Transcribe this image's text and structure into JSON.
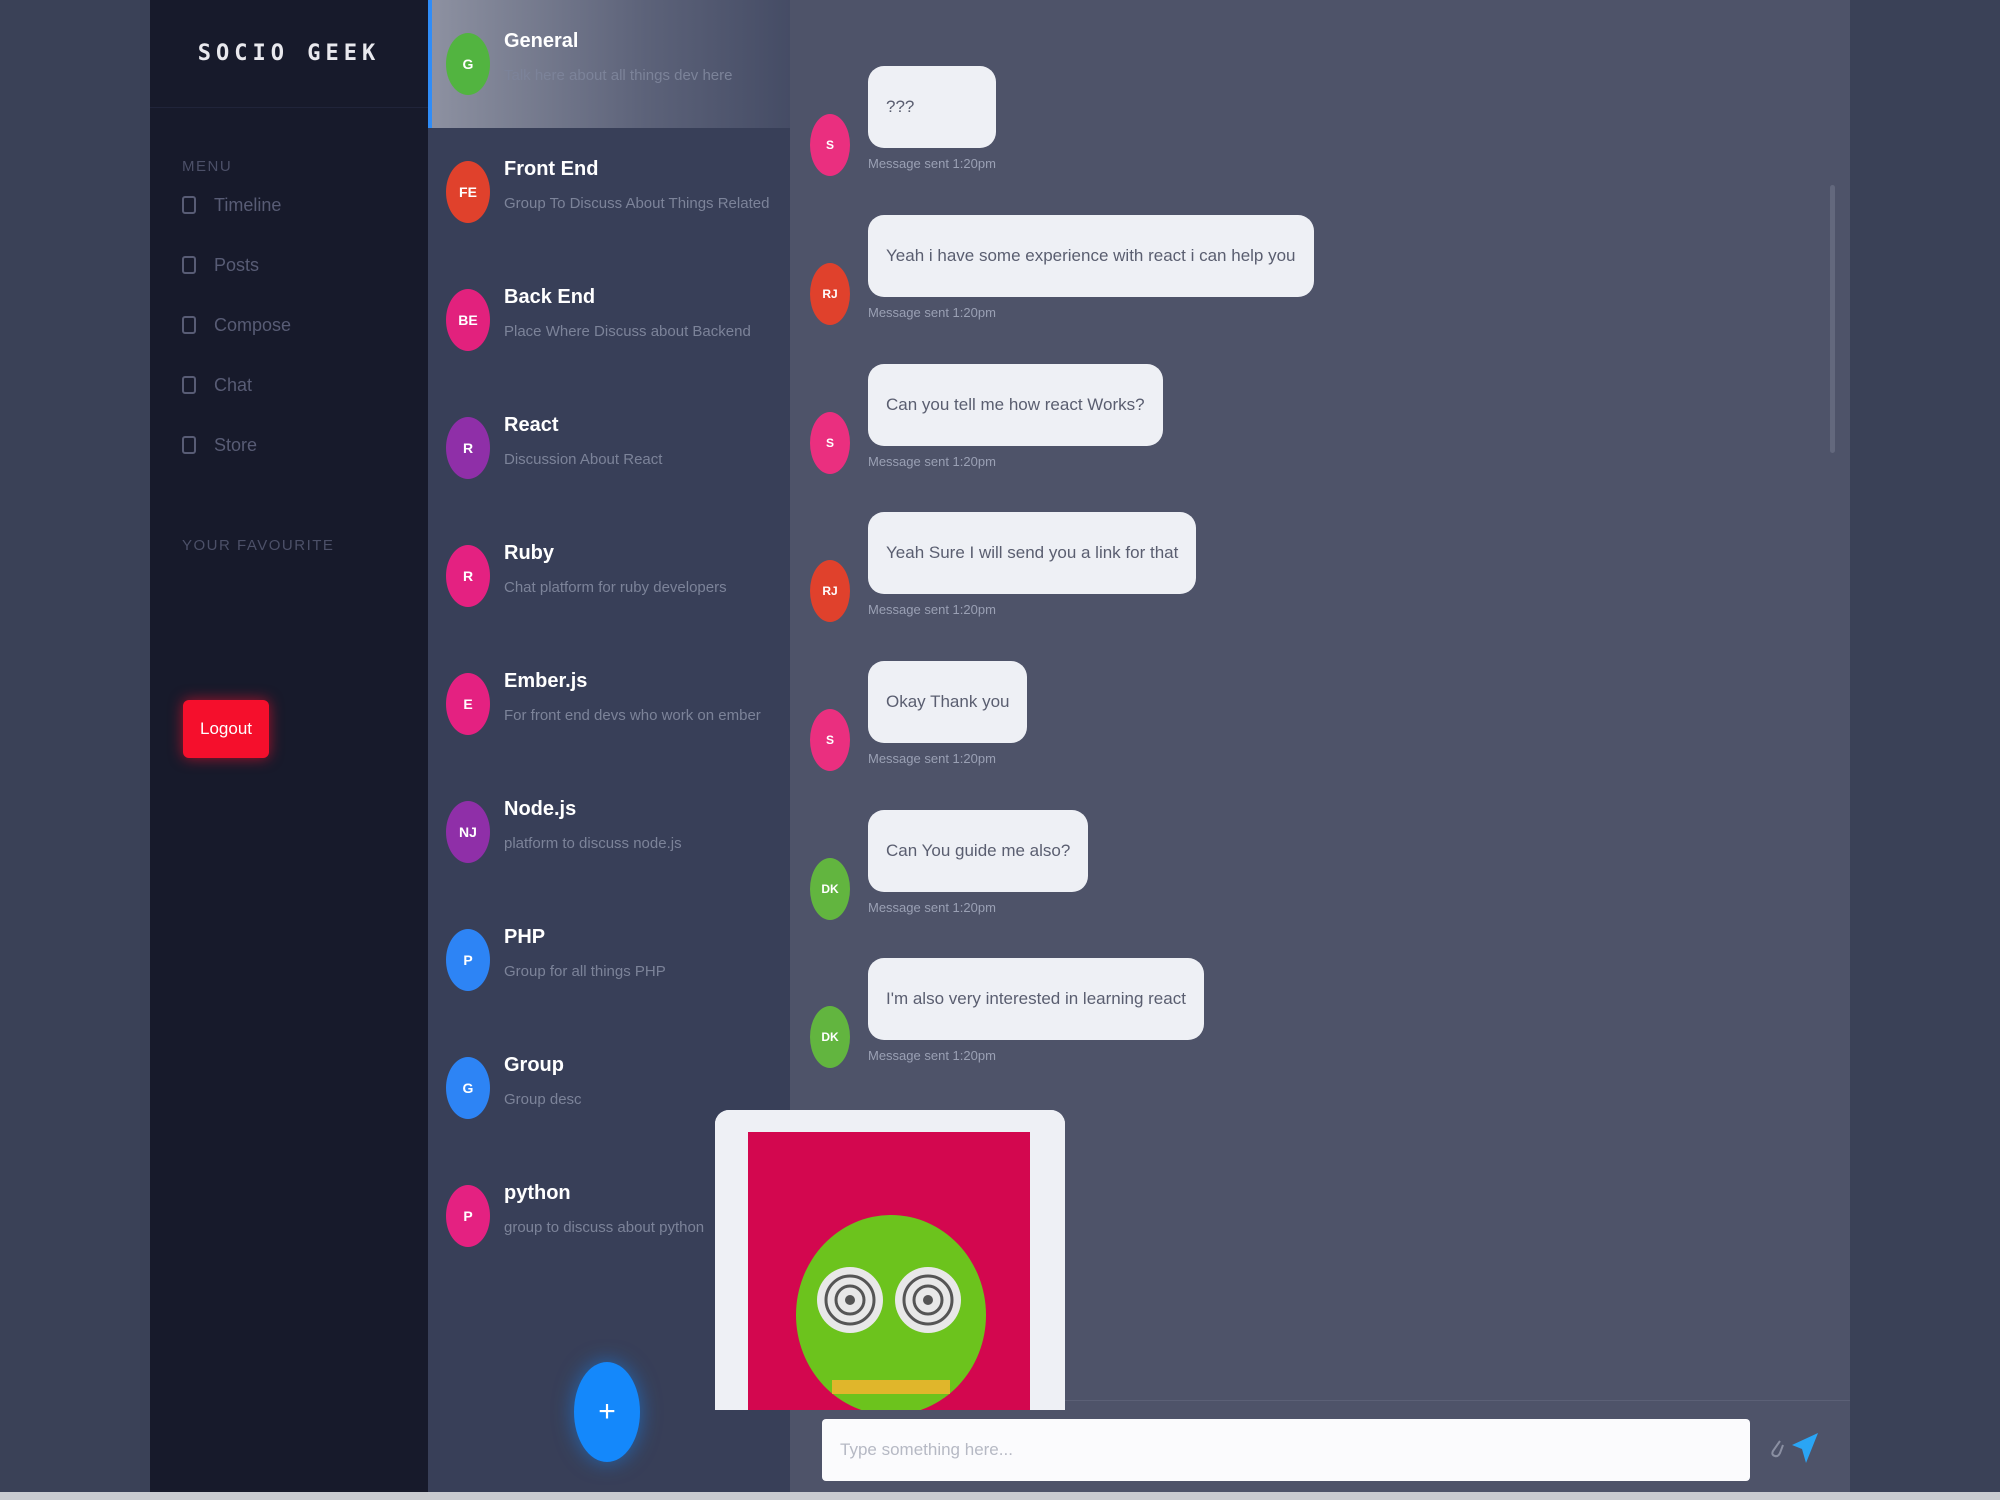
{
  "app": {
    "brand": "SOCIO GEEK"
  },
  "nav": {
    "menu_heading": "MENU",
    "items": [
      {
        "label": "Timeline",
        "icon": "lock-icon"
      },
      {
        "label": "Posts",
        "icon": "file-icon"
      },
      {
        "label": "Compose",
        "icon": "edit-icon"
      },
      {
        "label": "Chat",
        "icon": "chat-icon"
      },
      {
        "label": "Store",
        "icon": "store-icon"
      }
    ],
    "favourites_heading": "YOUR FAVOURITE",
    "logout_label": "Logout"
  },
  "groups": [
    {
      "initials": "G",
      "name": "General",
      "desc": "Talk here about all things dev here",
      "color": "#52b440",
      "active": true
    },
    {
      "initials": "FE",
      "name": "Front End",
      "desc": "Group To Discuss About Things Related",
      "color": "#e0412c"
    },
    {
      "initials": "BE",
      "name": "Back End",
      "desc": "Place Where Discuss about Backend",
      "color": "#e2217d"
    },
    {
      "initials": "R",
      "name": "React",
      "desc": "Discussion About React",
      "color": "#8f2fa8"
    },
    {
      "initials": "R",
      "name": "Ruby",
      "desc": "Chat platform for ruby developers",
      "color": "#e42181"
    },
    {
      "initials": "E",
      "name": "Ember.js",
      "desc": "For front end devs who work on ember",
      "color": "#e42181"
    },
    {
      "initials": "NJ",
      "name": "Node.js",
      "desc": "platform to discuss node.js",
      "color": "#8f2fa8"
    },
    {
      "initials": "P",
      "name": "PHP",
      "desc": "Group for all things PHP",
      "color": "#2d84f5"
    },
    {
      "initials": "G",
      "name": "Group",
      "desc": "Group desc",
      "color": "#2d84f5"
    },
    {
      "initials": "P",
      "name": "python",
      "desc": "group to discuss about python",
      "color": "#e42181"
    }
  ],
  "fab_label": "+",
  "messages": [
    {
      "initials": "S",
      "text": "???",
      "meta": "Message sent 1:20pm",
      "color": "#ea2f7f"
    },
    {
      "initials": "RJ",
      "text": "Yeah i have some experience with react i can help you",
      "meta": "Message sent 1:20pm",
      "color": "#e0412c"
    },
    {
      "initials": "S",
      "text": "Can you tell me how react Works?",
      "meta": "Message sent 1:20pm",
      "color": "#ea2f7f"
    },
    {
      "initials": "RJ",
      "text": "Yeah Sure I will send you a link for that",
      "meta": "Message sent 1:20pm",
      "color": "#e0412c"
    },
    {
      "initials": "S",
      "text": "Okay Thank you",
      "meta": "Message sent 1:20pm",
      "color": "#ea2f7f"
    },
    {
      "initials": "DK",
      "text": "Can You guide me also?",
      "meta": "Message sent 1:20pm",
      "color": "#62b53f"
    },
    {
      "initials": "DK",
      "text": "I'm also very interested in learning react",
      "meta": "Message sent 1:20pm",
      "color": "#62b53f"
    }
  ],
  "composer": {
    "placeholder": "Type something here...",
    "attach_icon": "paperclip-icon",
    "send_icon": "send-icon"
  }
}
